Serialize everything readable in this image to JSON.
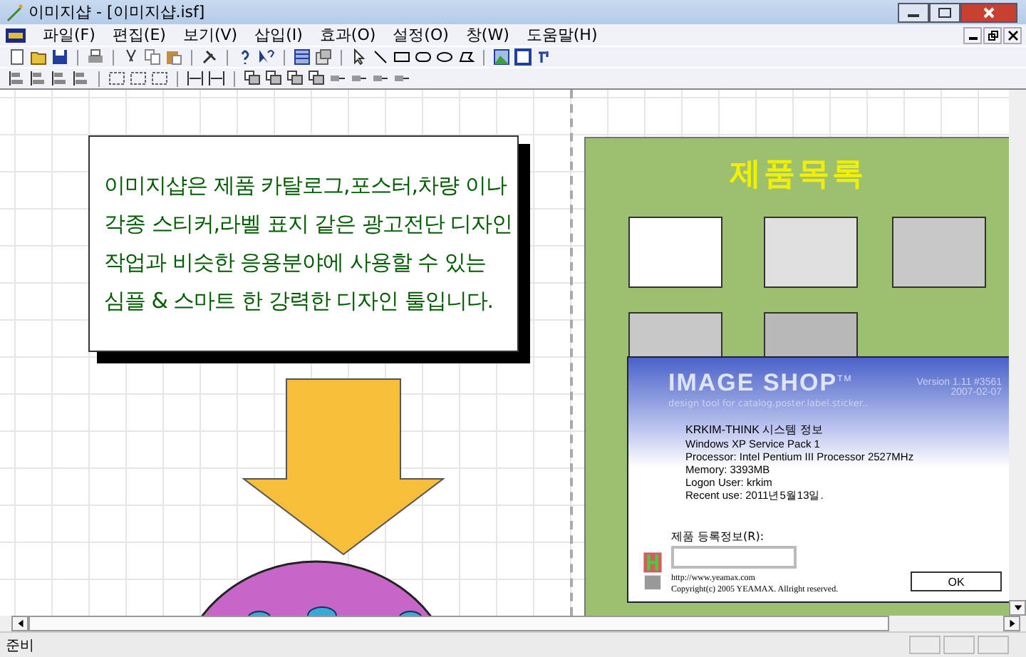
{
  "window": {
    "title": "이미지샵 - [이미지샵.isf]"
  },
  "menu": [
    {
      "label": "파일(F)"
    },
    {
      "label": "편집(E)"
    },
    {
      "label": "보기(V)"
    },
    {
      "label": "삽입(I)"
    },
    {
      "label": "효과(O)"
    },
    {
      "label": "설정(O)"
    },
    {
      "label": "창(W)"
    },
    {
      "label": "도움말(H)"
    }
  ],
  "canvas": {
    "text_box": {
      "lines": [
        "이미지샵은 제품 카탈로그,포스터,차량 이나",
        "각종 스티커,라벨 표지 같은 광고전단 디자인",
        "작업과 비슷한 응용분야에 사용할 수 있는",
        "심플 & 스마트 한 강력한 디자인 툴입니다."
      ]
    },
    "product_panel": {
      "title": "제품목록",
      "swatches": [
        {
          "color": "#ffffff"
        },
        {
          "color": "#e0e0e0"
        },
        {
          "color": "#c8c8c8"
        },
        {
          "color": "#c8c8c8"
        },
        {
          "color": "#b8b8b8"
        }
      ]
    }
  },
  "about_dialog": {
    "logo": "IMAGE SHOP",
    "trademark": "TM",
    "tagline": "design tool for catalog.poster.label.sticker..",
    "version": "Version 1.11 #3561",
    "date": "2007-02-07",
    "heading": "KRKIM-THINK 시스템 정보",
    "info": [
      "Windows XP Service Pack 1",
      "Processor: Intel Pentium III Processor 2527MHz",
      "Memory: 3393MB",
      "Logon User: krkim",
      "Recent use: 2011년5월13일."
    ],
    "registration_label": "제품 등록정보(R):",
    "url": "http://www.yeamax.com",
    "copyright": "Copyright(c) 2005 YEAMAX. Allright reserved.",
    "ok": "OK"
  },
  "status_bar": {
    "text": "준비"
  }
}
